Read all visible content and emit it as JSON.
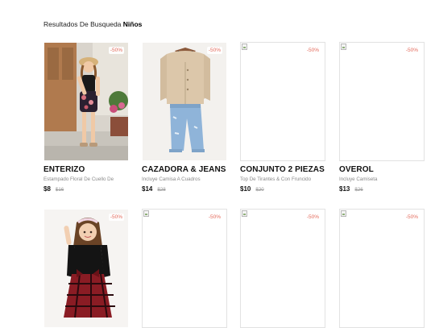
{
  "search": {
    "prefix": "Resultados De Busqueda",
    "term": "Niños"
  },
  "colors": {
    "discount": "#e46b5c"
  },
  "products": [
    {
      "image": "photo",
      "discount": "-50%",
      "title": "ENTERIZO",
      "description": "Estampado Floral De Cuello De",
      "price": "$8",
      "old_price": "$16"
    },
    {
      "image": "photo",
      "discount": "-50%",
      "title": "CAZADORA & JEANS",
      "description": "Incluye Camisa A Cuadros",
      "price": "$14",
      "old_price": "$28"
    },
    {
      "image": "broken",
      "discount": "-50%",
      "title": "CONJUNTO 2 PIEZAS",
      "description": "Top De Tirantes & Con Fruncido",
      "price": "$10",
      "old_price": "$20"
    },
    {
      "image": "broken",
      "discount": "-50%",
      "title": "OVEROL",
      "description": "Incluye Camiseta",
      "price": "$13",
      "old_price": "$26"
    },
    {
      "image": "photo",
      "discount": "-50%"
    },
    {
      "image": "broken",
      "discount": "-50%"
    },
    {
      "image": "broken",
      "discount": "-50%"
    },
    {
      "image": "broken",
      "discount": "-50%"
    }
  ]
}
